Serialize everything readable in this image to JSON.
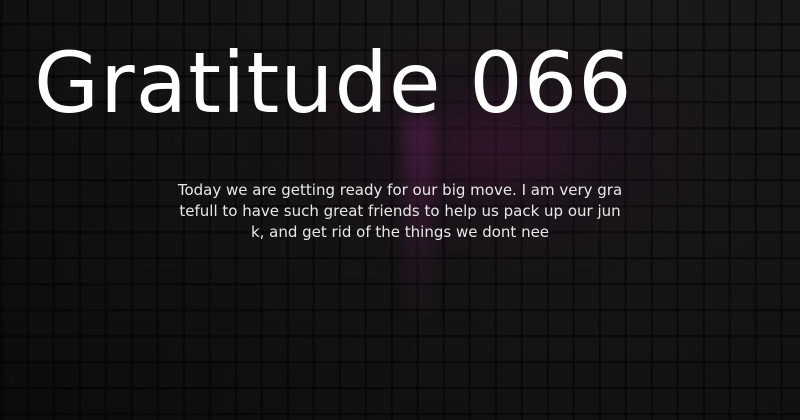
{
  "card": {
    "title": "Gratitude 066",
    "excerpt": "Today we are getting ready for  our big move.  I am very gra\ntefull to have such great friends to help us pack up our jun\nk, and get rid of the things we dont nee"
  },
  "colors": {
    "background": "#151515",
    "accent": "#5a1a50",
    "text": "#ffffff"
  }
}
